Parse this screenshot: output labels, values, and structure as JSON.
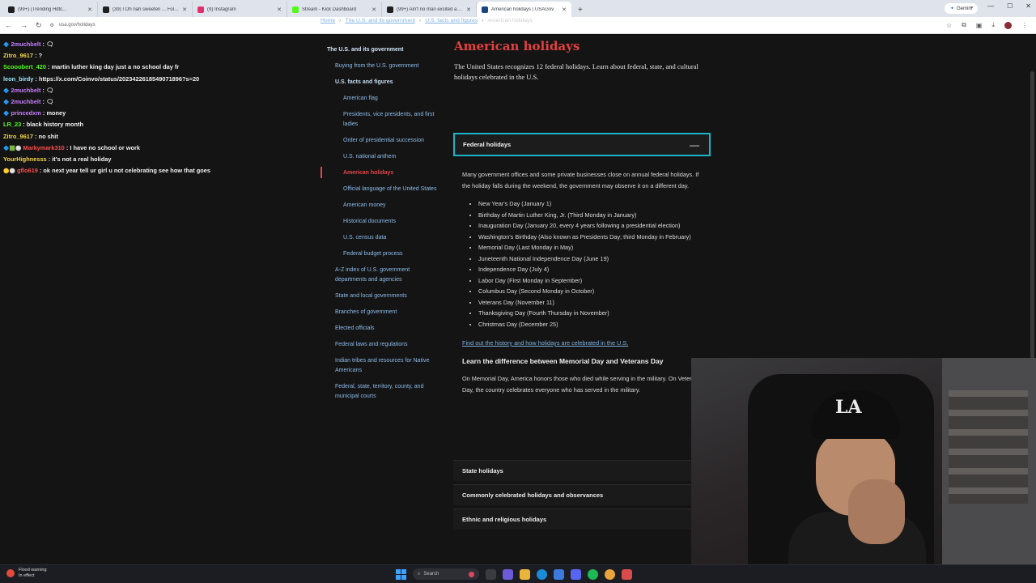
{
  "browser": {
    "tabs": [
      {
        "title": "(99+) (Trending Hdtc...",
        "color": "#1f1f1f",
        "active": false
      },
      {
        "title": "(39) I Oh nah sweeten ... Folie rush",
        "color": "#1f1f1f",
        "active": false
      },
      {
        "title": "(9) Instagram",
        "color": "#e1306c",
        "active": false
      },
      {
        "title": "Stream - Kick Dashboard",
        "color": "#53fc18",
        "active": false
      },
      {
        "title": "(99+) Ain't no man excited abo...",
        "color": "#1f1f1f",
        "active": false
      },
      {
        "title": "American holidays | USAGov",
        "color": "#1a4480",
        "active": true
      }
    ],
    "new_tab": "+",
    "gemini_label": "Gemini",
    "url": "usa.gov/holidays"
  },
  "chat": [
    {
      "user": "2muchbelt",
      "color": "#c77dff",
      "text": "🗨",
      "badge": "🔷"
    },
    {
      "user": "Zitro_9617",
      "color": "#f5d742",
      "text": "?",
      "badge": ""
    },
    {
      "user": "Scooobert_420",
      "color": "#53fc18",
      "text": "martin luther king day just a no school day fr",
      "badge": ""
    },
    {
      "user": "leon_birdy",
      "color": "#9ee7ff",
      "text": "https://x.com/Coinvo/status/2023422618549071896?s=20",
      "badge": ""
    },
    {
      "user": "2muchbelt",
      "color": "#c77dff",
      "text": "🗨",
      "badge": "🔷"
    },
    {
      "user": "2muchbelt",
      "color": "#c77dff",
      "text": "🗨",
      "badge": "🔷"
    },
    {
      "user": "princedxm",
      "color": "#c77dff",
      "text": "money",
      "badge": "🔷"
    },
    {
      "user": "LR_23",
      "color": "#53fc18",
      "text": "black history month",
      "badge": ""
    },
    {
      "user": "Zitro_9617",
      "color": "#f5d742",
      "text": "no shit",
      "badge": ""
    },
    {
      "user": "Markymark310",
      "color": "#ff4d4d",
      "text": "I have no school or work",
      "badge": "🔷🟩⚪"
    },
    {
      "user": "YourHighnesss",
      "color": "#f5d742",
      "text": "it's not a real holiday",
      "badge": ""
    },
    {
      "user": "gflo619",
      "color": "#ff4d4d",
      "text": "ok next year tell ur girl u not celebrating see how that goes",
      "badge": "🟡⚪"
    }
  ],
  "breadcrumb": [
    "Home",
    "The U.S. and its government",
    "U.S. facts and figures",
    "American holidays"
  ],
  "sidenav": [
    {
      "label": "The U.S. and its government",
      "level": 0
    },
    {
      "label": "Buying from the U.S. government",
      "level": 1
    },
    {
      "label": "U.S. facts and figures",
      "level": 1,
      "bold": true
    },
    {
      "label": "American flag",
      "level": 2
    },
    {
      "label": "Presidents, vice presidents, and first ladies",
      "level": 2
    },
    {
      "label": "Order of presidential succession",
      "level": 2
    },
    {
      "label": "U.S. national anthem",
      "level": 2
    },
    {
      "label": "American holidays",
      "level": 2,
      "current": true
    },
    {
      "label": "Official language of the United States",
      "level": 2
    },
    {
      "label": "American money",
      "level": 2
    },
    {
      "label": "Historical documents",
      "level": 2
    },
    {
      "label": "U.S. census data",
      "level": 2
    },
    {
      "label": "Federal budget process",
      "level": 2
    },
    {
      "label": "A-Z index of U.S. government departments and agencies",
      "level": 1
    },
    {
      "label": "State and local governments",
      "level": 1
    },
    {
      "label": "Branches of government",
      "level": 1
    },
    {
      "label": "Elected officials",
      "level": 1
    },
    {
      "label": "Federal laws and regulations",
      "level": 1
    },
    {
      "label": "Indian tribes and resources for Native Americans",
      "level": 1
    },
    {
      "label": "Federal, state, territory, county, and municipal courts",
      "level": 1
    }
  ],
  "main": {
    "title": "American holidays",
    "intro": "The United States recognizes 12 federal holidays. Learn about federal, state, and cultural holidays celebrated in the U.S.",
    "federal": {
      "heading": "Federal holidays",
      "collapse_symbol": "—",
      "description": "Many government offices and some private businesses close on annual federal holidays. If the holiday falls during the weekend, the government may observe it on a different day.",
      "holidays": [
        "New Year's Day (January 1)",
        "Birthday of Martin Luther King, Jr. (Third Monday in January)",
        "Inauguration Day (January 20, every 4 years following a presidential election)",
        "Washington's Birthday (Also known as Presidents Day; third Monday in February)",
        "Memorial Day (Last Monday in May)",
        "Juneteenth National Independence Day (June 19)",
        "Independence Day (July 4)",
        "Labor Day (First Monday in September)",
        "Columbus Day (Second Monday in October)",
        "Veterans Day (November 11)",
        "Thanksgiving Day (Fourth Thursday in November)",
        "Christmas Day (December 25)"
      ],
      "link": "Find out the history and how holidays are celebrated in the U.S.",
      "subheading": "Learn the difference between Memorial Day and Veterans Day",
      "subtext": "On Memorial Day, America honors those who died while serving in the military. On Veterans Day, the country celebrates everyone who has served in the military."
    },
    "other_sections": [
      "State holidays",
      "Commonly celebrated holidays and observances",
      "Ethnic and religious holidays"
    ]
  },
  "taskbar": {
    "weather_line1": "Flood warning",
    "weather_line2": "In effect",
    "search_placeholder": "Search"
  },
  "webcam": {
    "cap_logo": "LA"
  }
}
